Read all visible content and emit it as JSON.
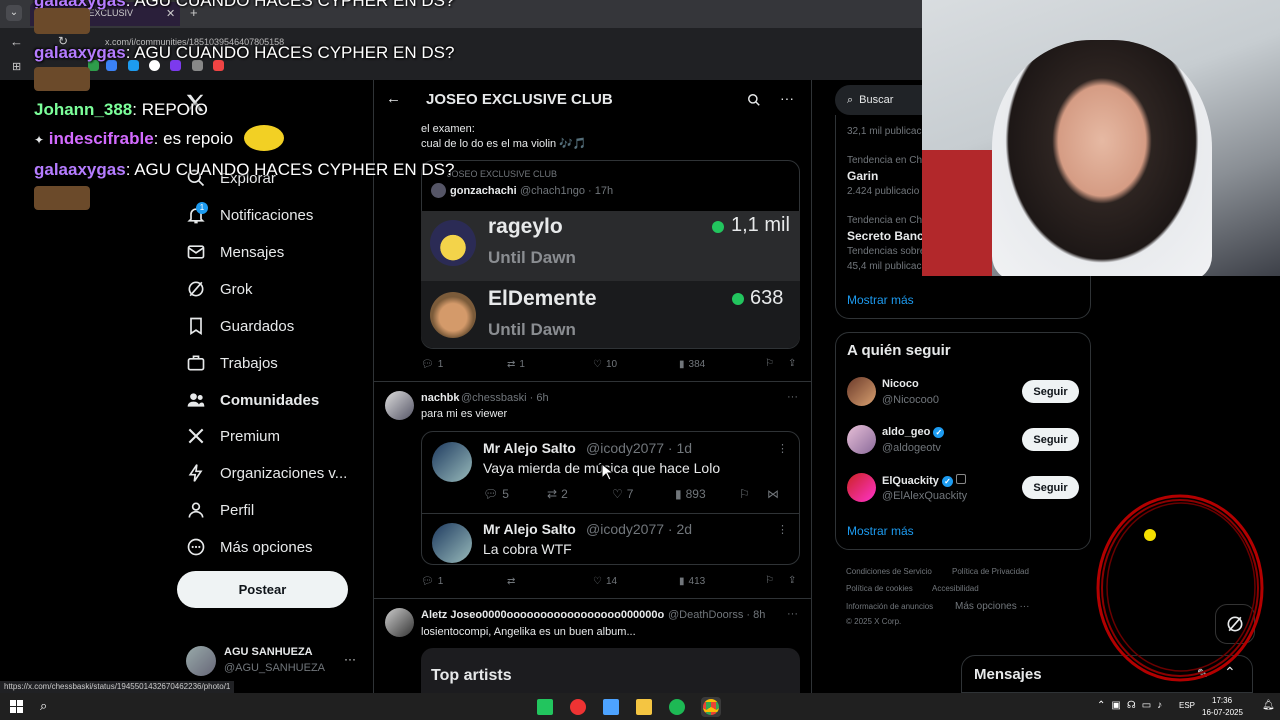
{
  "browser": {
    "tab_title": "dad JOSEO EXCLUSIV",
    "url": "x.com/i/communities/1851039546407805158",
    "status_url": "https://x.com/chessbaski/status/1945501432670462236/photo/1"
  },
  "nav": {
    "explore": "Explorar",
    "notifications": "Notificaciones",
    "notif_badge": "1",
    "messages": "Mensajes",
    "grok": "Grok",
    "bookmarks": "Guardados",
    "jobs": "Trabajos",
    "communities": "Comunidades",
    "premium": "Premium",
    "orgs": "Organizaciones v...",
    "profile": "Perfil",
    "more": "Más opciones",
    "post_button": "Postear",
    "user_name": "AGU SANHUEZA",
    "user_handle": "@AGU_SANHUEZA"
  },
  "feed": {
    "header_title": "JOSEO EXCLUSIVE CLUB",
    "post1": {
      "text_line1": "el examen:",
      "text_line2": "cual de lo do es el ma violin 🎶🎵",
      "quote_community": "JOSEO EXCLUSIVE CLUB",
      "quote_name": "gonzachachi",
      "quote_handle_time": "@chach1ngo · 17h",
      "row1_name": "rageylo",
      "row1_game": "Until Dawn",
      "row1_viewers": "1,1 mil",
      "row2_name": "ElDemente",
      "row2_game": "Until Dawn",
      "row2_viewers": "638",
      "replies": "1",
      "reposts": "1",
      "likes": "10",
      "views": "384"
    },
    "post2": {
      "name": "nachbk",
      "handle_time": "@chessbaski · 6h",
      "text": "para mi es viewer",
      "q1_name": "Mr Alejo Salto",
      "q1_handle_time": "@icody2077 · 1d",
      "q1_text": "Vaya mierda de música que hace Lolo",
      "q1_replies": "5",
      "q1_reposts": "2",
      "q1_likes": "7",
      "q1_views": "893",
      "q2_name": "Mr Alejo Salto",
      "q2_handle_time": "@icody2077 · 2d",
      "q2_text": "La cobra WTF",
      "replies": "1",
      "reposts": "",
      "likes": "14",
      "views": "413"
    },
    "post3": {
      "name": "Aletz Joseo0000ooooooooooooooooo000000o",
      "handle_time": "@DeathDoorss · 8h",
      "text": "losientocompi, Angelika es un buen album...",
      "card_title": "Top artists"
    }
  },
  "right": {
    "search_placeholder": "Buscar",
    "trend0_count": "32,1 mil publicacio",
    "trend1_context": "Tendencia en Chi",
    "trend1_name": "Garin",
    "trend1_count": "2.424 publicacio",
    "trend2_context": "Tendencia en Chi",
    "trend2_name": "Secreto Banca",
    "trend2_extra": "Tendencias sobre",
    "trend2_count": "45,4 mil publicac",
    "show_more_1": "Mostrar más",
    "who_to_follow": "A quién seguir",
    "follow": [
      {
        "name": "Nicoco",
        "handle": "@Nicocoo0",
        "button": "Seguir"
      },
      {
        "name": "aldo_geo",
        "handle": "@aldogeotv",
        "button": "Seguir"
      },
      {
        "name": "ElQuackity",
        "handle": "@ElAlexQuackity",
        "button": "Seguir"
      }
    ],
    "show_more_2": "Mostrar más",
    "footer": {
      "terms": "Condiciones de Servicio",
      "privacy": "Política de Privacidad",
      "cookies": "Política de cookies",
      "accessibility": "Accesibilidad",
      "ads": "Información de anuncios",
      "more": "Más opciones ···",
      "copyright": "© 2025 X Corp."
    },
    "messages_drawer": "Mensajes"
  },
  "chat": [
    {
      "user": "galaaxygas",
      "msg": ": AGU CUANDO HACES CYPHER EN DS?",
      "color": "#b57cff"
    },
    {
      "user": "Johann_388",
      "msg": ": REPOIO",
      "color": "#7cff9a"
    },
    {
      "user": "indescifrable",
      "msg": ": es repoio",
      "color": "#d36bff"
    },
    {
      "user": "galaaxygas",
      "msg": ": AGU CUANDO HACES CYPHER EN DS?",
      "color": "#b57cff"
    }
  ],
  "taskbar": {
    "lang": "ESP",
    "time": "17:36",
    "date": "16-07-2025"
  },
  "colors": {
    "accent": "#1d9bf0",
    "online": "#22c55e",
    "chat_text": "#ffffff"
  }
}
